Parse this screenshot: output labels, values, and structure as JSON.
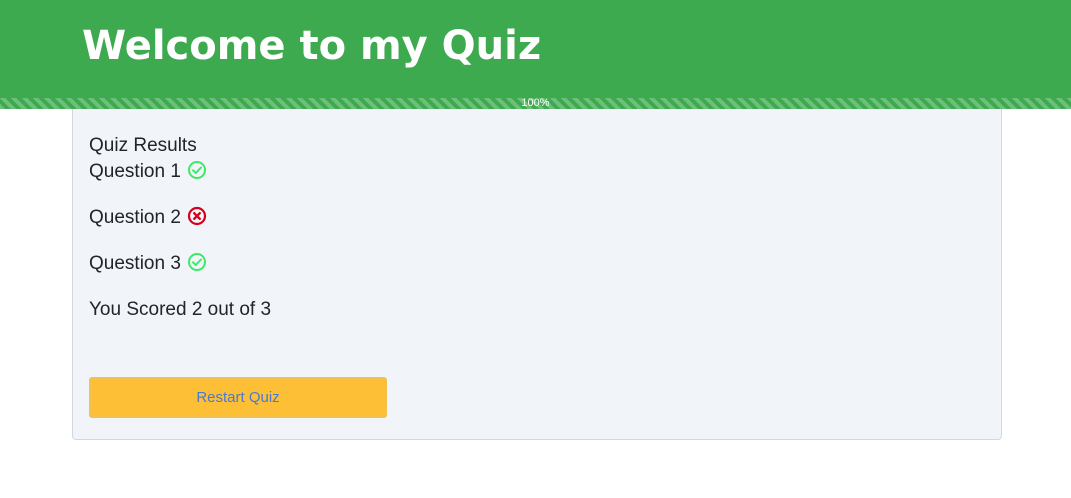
{
  "header": {
    "title": "Welcome to my Quiz",
    "background_color": "#3eaa4f"
  },
  "progress": {
    "value_percent": 100,
    "label": "100%"
  },
  "results": {
    "heading": "Quiz Results",
    "questions": [
      {
        "label": "Question 1",
        "correct": true,
        "icon": "check-circle-icon",
        "color": "#3ee86a"
      },
      {
        "label": "Question 2",
        "correct": false,
        "icon": "x-circle-icon",
        "color": "#d7001b"
      },
      {
        "label": "Question 3",
        "correct": true,
        "icon": "check-circle-icon",
        "color": "#3ee86a"
      }
    ],
    "score_text": "You Scored 2 out of 3"
  },
  "restart_button": {
    "label": "Restart Quiz",
    "background_color": "#fdbf35",
    "text_color": "#4a7ad1"
  }
}
